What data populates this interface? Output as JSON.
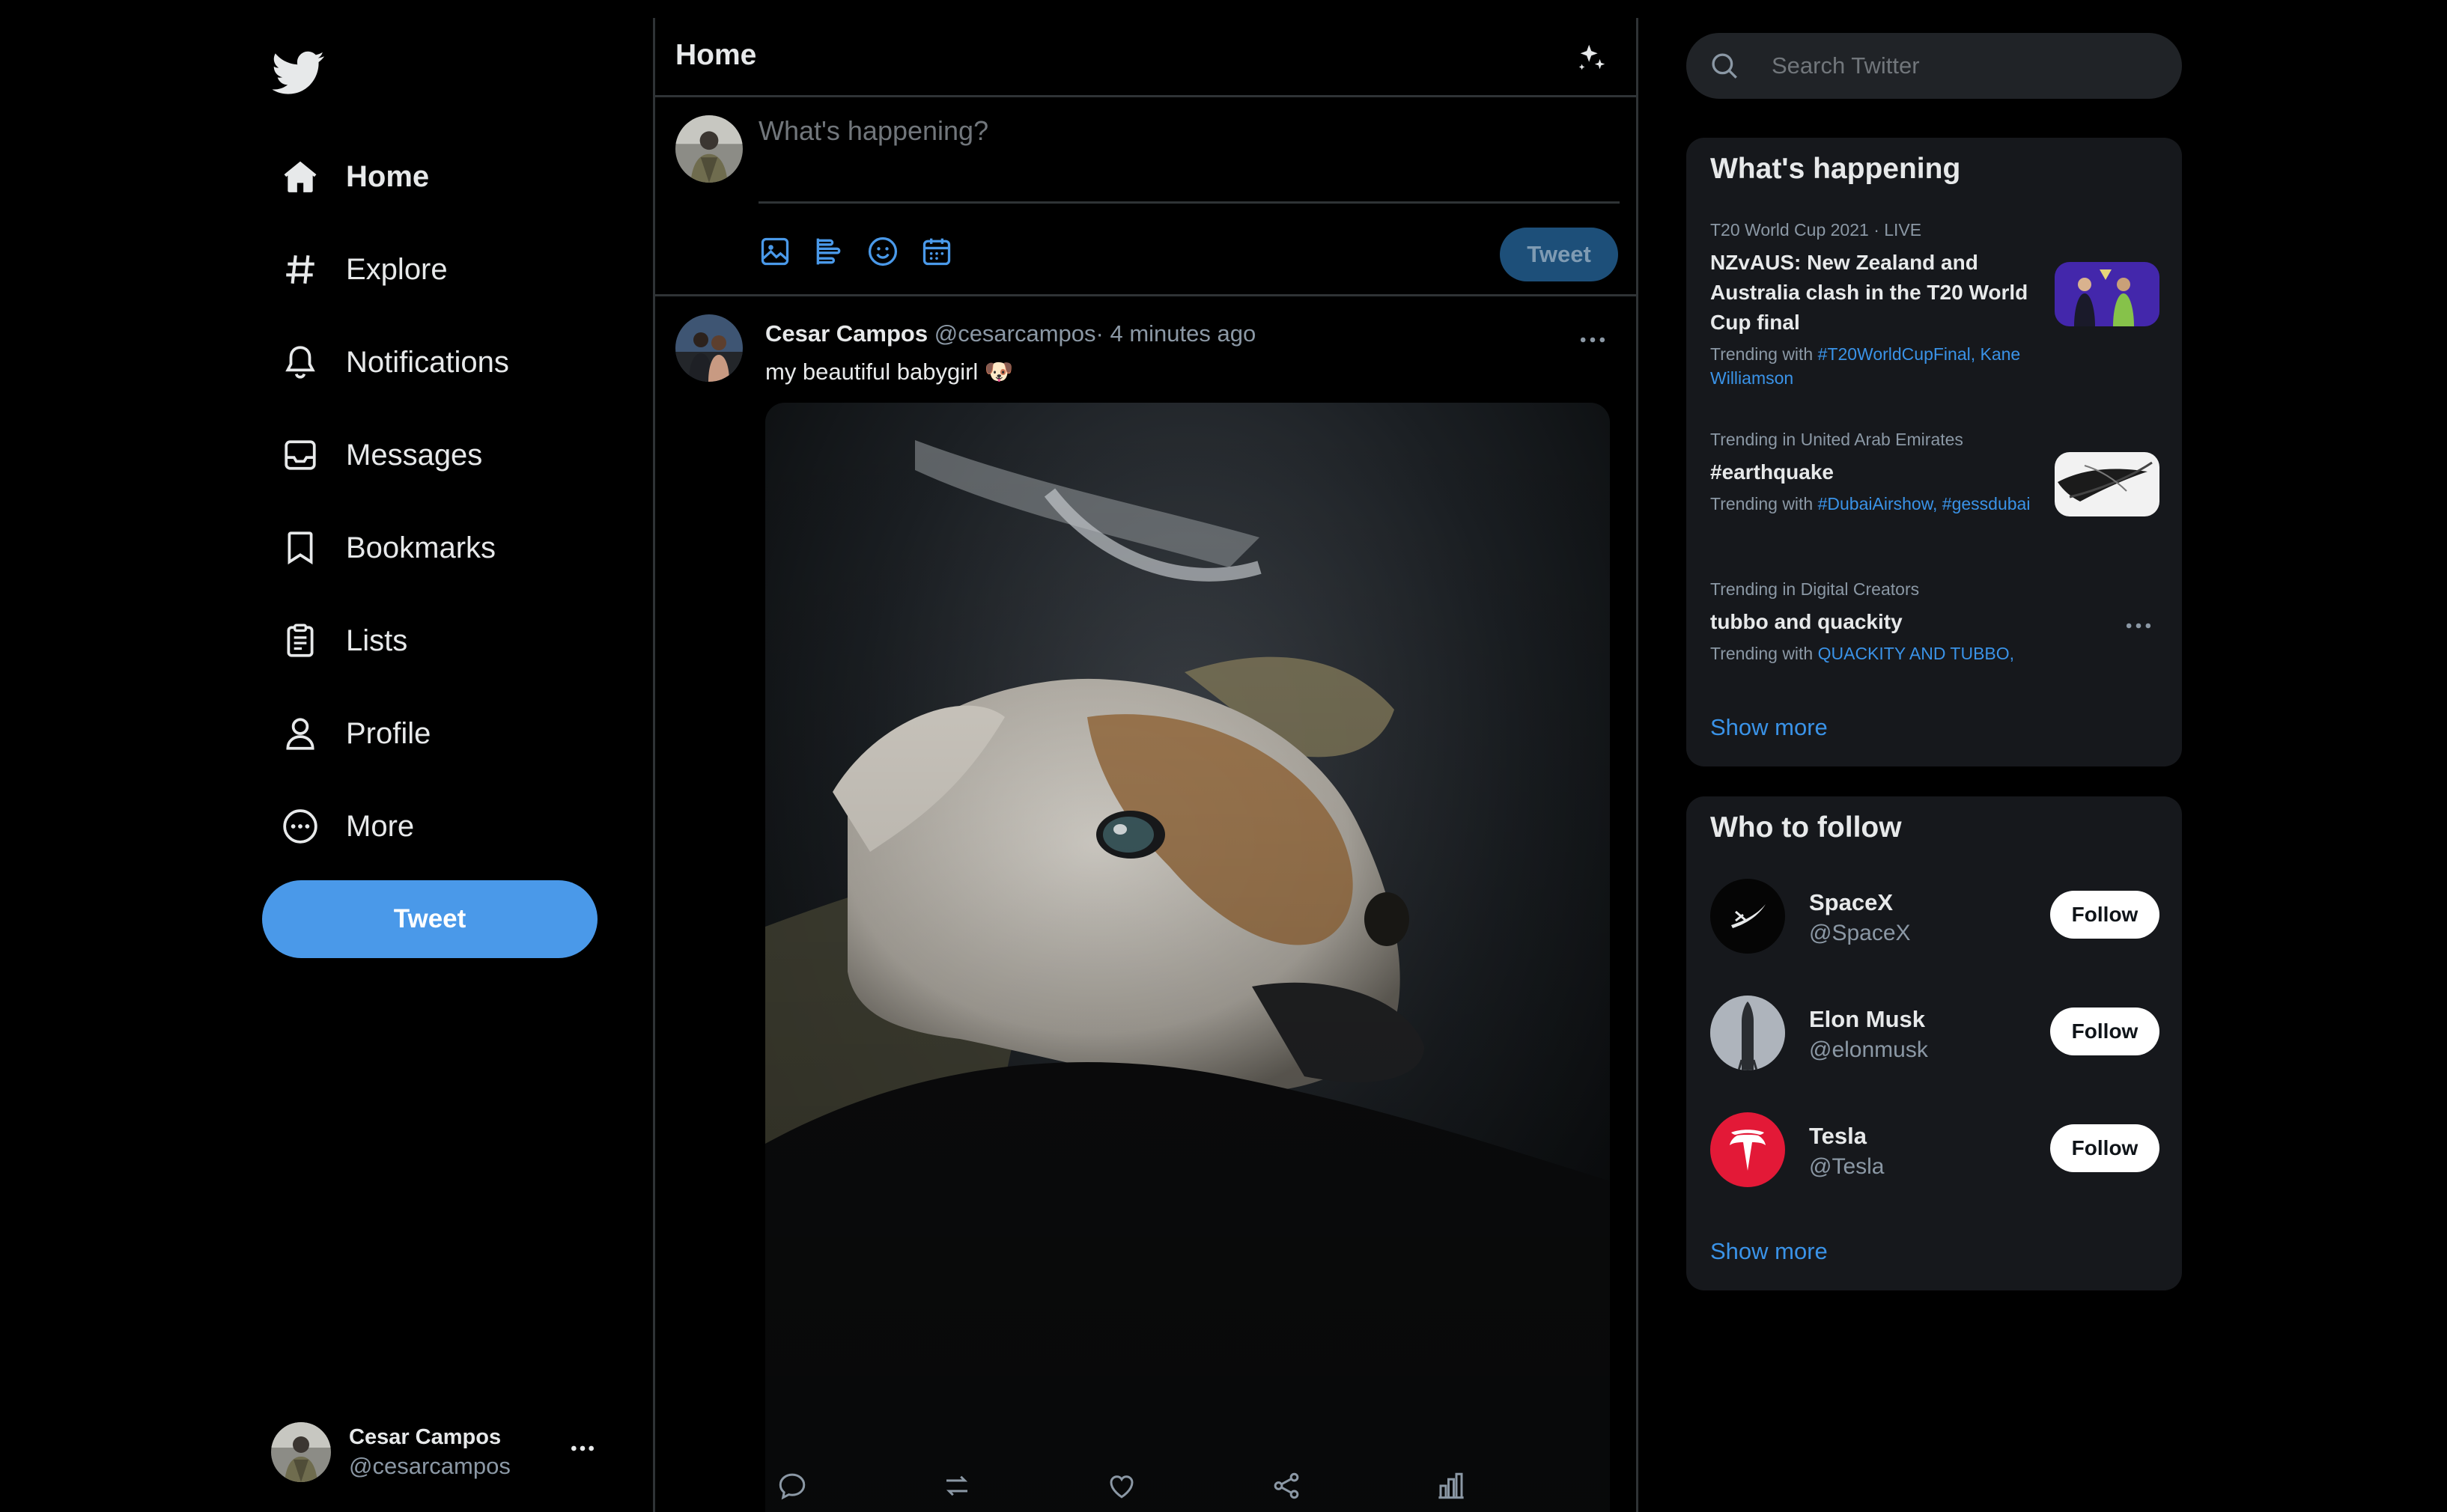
{
  "nav": {
    "items": [
      {
        "label": "Home",
        "icon": "home-icon"
      },
      {
        "label": "Explore",
        "icon": "hashtag-icon"
      },
      {
        "label": "Notifications",
        "icon": "bell-icon"
      },
      {
        "label": "Messages",
        "icon": "envelope-icon"
      },
      {
        "label": "Bookmarks",
        "icon": "bookmark-icon"
      },
      {
        "label": "Lists",
        "icon": "list-icon"
      },
      {
        "label": "Profile",
        "icon": "user-icon"
      },
      {
        "label": "More",
        "icon": "more-circle-icon"
      }
    ],
    "tweet_button": "Tweet"
  },
  "account": {
    "name": "Cesar Campos",
    "handle": "@cesarcampos"
  },
  "header": {
    "title": "Home"
  },
  "composer": {
    "placeholder": "What's happening?",
    "tweet_button": "Tweet"
  },
  "tweet": {
    "name": "Cesar Campos",
    "handle": "@cesarcampos",
    "time": "· 4 minutes ago",
    "text": "my beautiful babygirl 🐶"
  },
  "search": {
    "placeholder": "Search Twitter"
  },
  "whats_happening": {
    "title": "What's happening",
    "trends": [
      {
        "meta": "T20 World Cup 2021 · LIVE",
        "title": "NZvAUS: New Zealand and Australia clash in the T20 World Cup final",
        "with_prefix": "Trending with ",
        "tags": "#T20WorldCupFinal, Kane Williamson"
      },
      {
        "meta": "Trending in United Arab Emirates",
        "title": "#earthquake",
        "with_prefix": "Trending with ",
        "tags": "#DubaiAirshow, #gessdubai"
      },
      {
        "meta": "Trending in Digital Creators",
        "title": "tubbo and quackity",
        "with_prefix": "Trending with ",
        "tags": "QUACKITY AND TUBBO,"
      }
    ],
    "show_more": "Show more"
  },
  "who_to_follow": {
    "title": "Who to follow",
    "accounts": [
      {
        "name": "SpaceX",
        "handle": "@SpaceX",
        "button": "Follow"
      },
      {
        "name": "Elon Musk",
        "handle": "@elonmusk",
        "button": "Follow"
      },
      {
        "name": "Tesla",
        "handle": "@Tesla",
        "button": "Follow"
      }
    ],
    "show_more": "Show more"
  },
  "colors": {
    "background": "#000000",
    "accent": "#4a99e9",
    "link": "#3a93e8",
    "panel": "#16181c",
    "border": "#2f3336",
    "muted_text": "#8b98a5",
    "tesla_red": "#e31937"
  }
}
